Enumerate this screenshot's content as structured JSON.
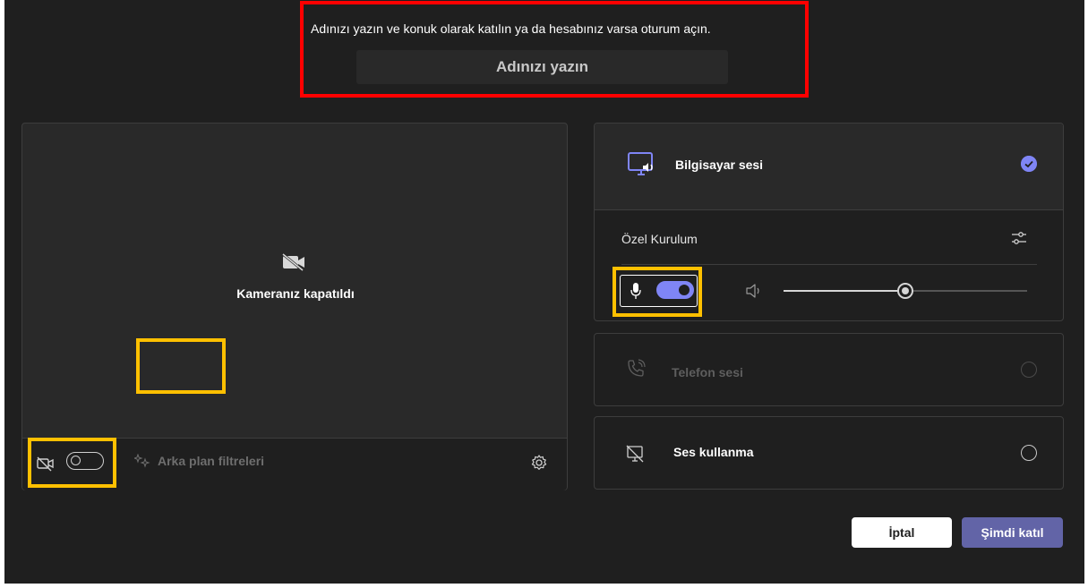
{
  "prompt": {
    "text": "Adınızı yazın ve konuk olarak katılın ya da hesabınız varsa oturum açın.",
    "name_input_placeholder": "Adınızı yazın",
    "name_input_value": ""
  },
  "video": {
    "camera_off_text": "Kameranız kapatıldı",
    "camera_toggle_on": false,
    "background_filters_label": "Arka plan filtreleri"
  },
  "audio": {
    "computer_audio_label": "Bilgisayar sesi",
    "computer_audio_selected": true,
    "custom_setup_label": "Özel Kurulum",
    "mic_toggle_on": true,
    "speaker_volume": 0.5,
    "phone_audio_label": "Telefon sesi",
    "phone_audio_enabled": false,
    "no_audio_label": "Ses kullanma"
  },
  "buttons": {
    "cancel_label": "İptal",
    "join_label": "Şimdi katıl"
  },
  "colors": {
    "background": "#1f1f1f",
    "accent": "#7f85f5",
    "join_button": "#6264a7",
    "highlight_red": "#ff0000",
    "highlight_yellow": "#ffc000"
  },
  "icons": {
    "computer_audio": "monitor-speaker-icon",
    "camera_off": "camera-off-icon",
    "background_filters": "sparkle-filter-icon",
    "settings": "gear-icon",
    "custom_setup": "sliders-icon",
    "mic": "mic-icon",
    "speaker": "speaker-icon",
    "phone": "phone-icon",
    "no_audio": "monitor-off-icon",
    "selected": "checkmark-circle-icon"
  }
}
